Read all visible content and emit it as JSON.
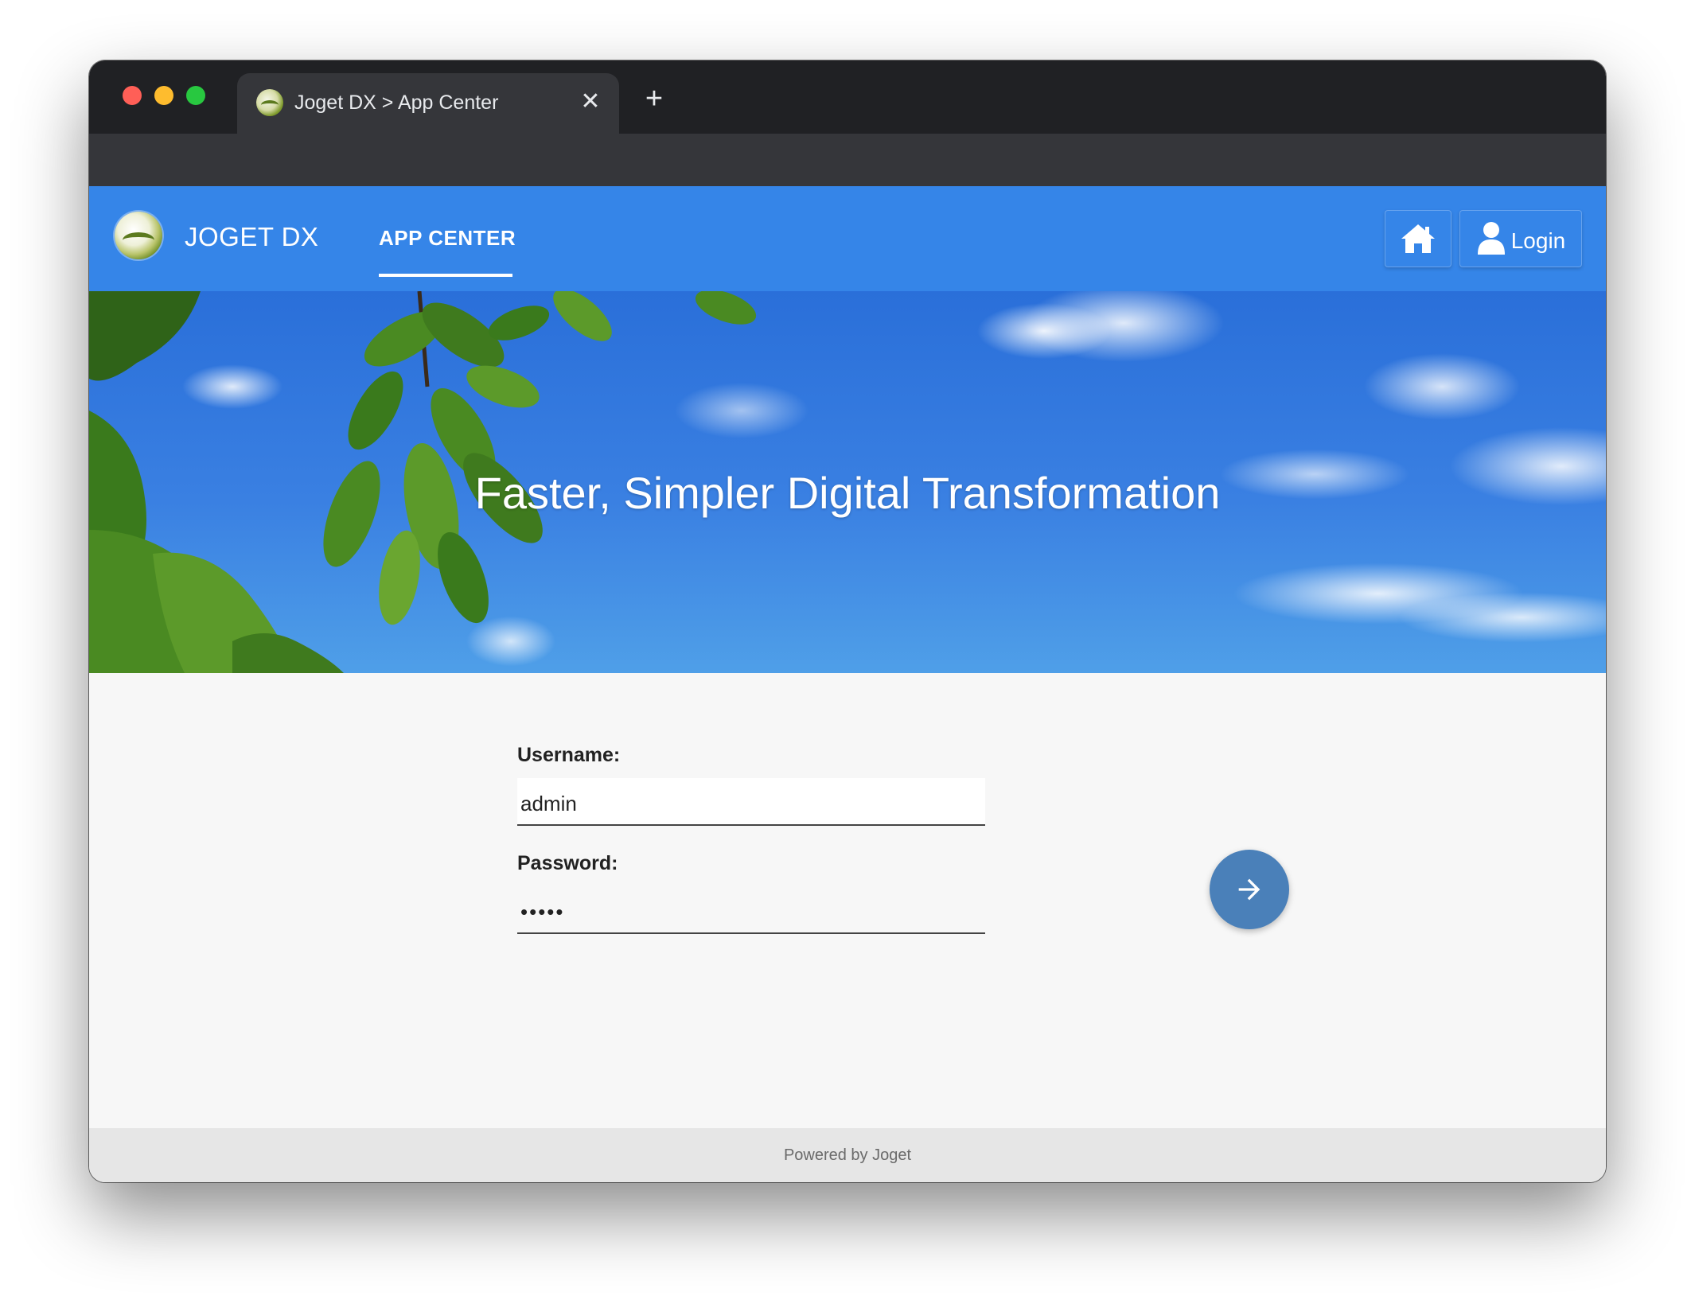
{
  "browser": {
    "tab_title": "Joget DX > App Center",
    "tab_close": "✕",
    "new_tab": "+",
    "address": ""
  },
  "header": {
    "brand": "JOGET DX",
    "nav_item": "APP CENTER",
    "login_label": "Login"
  },
  "hero": {
    "title": "Faster, Simpler Digital Transformation"
  },
  "login_form": {
    "username_label": "Username:",
    "username_value": "admin",
    "password_label": "Password:",
    "password_mask": "•••••"
  },
  "footer": {
    "text": "Powered by Joget"
  },
  "colors": {
    "header_blue": "#3585e8",
    "submit_button": "#4a80b9",
    "browser_chrome": "#202124"
  },
  "icons": [
    "back-arrow-icon",
    "forward-arrow-icon",
    "reload-icon",
    "site-info-icon",
    "install-app-icon",
    "bookmark-star-icon",
    "extensions-icon",
    "kebab-menu-icon",
    "home-icon",
    "user-icon",
    "arrow-right-icon"
  ]
}
